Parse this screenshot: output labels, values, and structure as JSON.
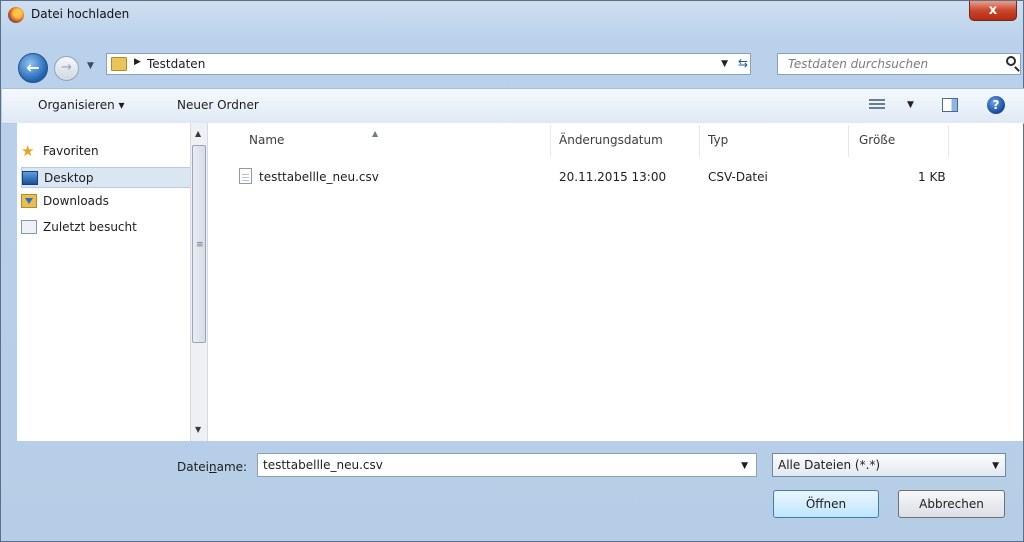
{
  "window": {
    "title": "Datei hochladen",
    "close_label": "x"
  },
  "address": {
    "path": "Testdaten",
    "search_placeholder": "Testdaten durchsuchen"
  },
  "toolbar": {
    "organize_label": "Organisieren ▾",
    "new_folder_label": "Neuer Ordner"
  },
  "sidebar": {
    "items": [
      {
        "label": "Favoriten",
        "icon": "star-icon"
      },
      {
        "label": "Desktop",
        "icon": "desktop-icon",
        "selected": true
      },
      {
        "label": "Downloads",
        "icon": "downloads-icon"
      },
      {
        "label": "Zuletzt besucht",
        "icon": "recent-icon"
      }
    ]
  },
  "files": {
    "columns": [
      "Name",
      "Änderungsdatum",
      "Typ",
      "Größe"
    ],
    "rows": [
      {
        "name": "testtabellle_neu.csv",
        "date": "20.11.2015 13:00",
        "type": "CSV-Datei",
        "size": "1 KB"
      }
    ]
  },
  "bottom": {
    "filename_label_pre": "Datei",
    "filename_label_u": "n",
    "filename_label_post": "ame:",
    "filename_value": "testtabellle_neu.csv",
    "filter_value": "Alle Dateien (*.*)",
    "open_label": "Öffnen",
    "cancel_label": "Abbrechen"
  }
}
